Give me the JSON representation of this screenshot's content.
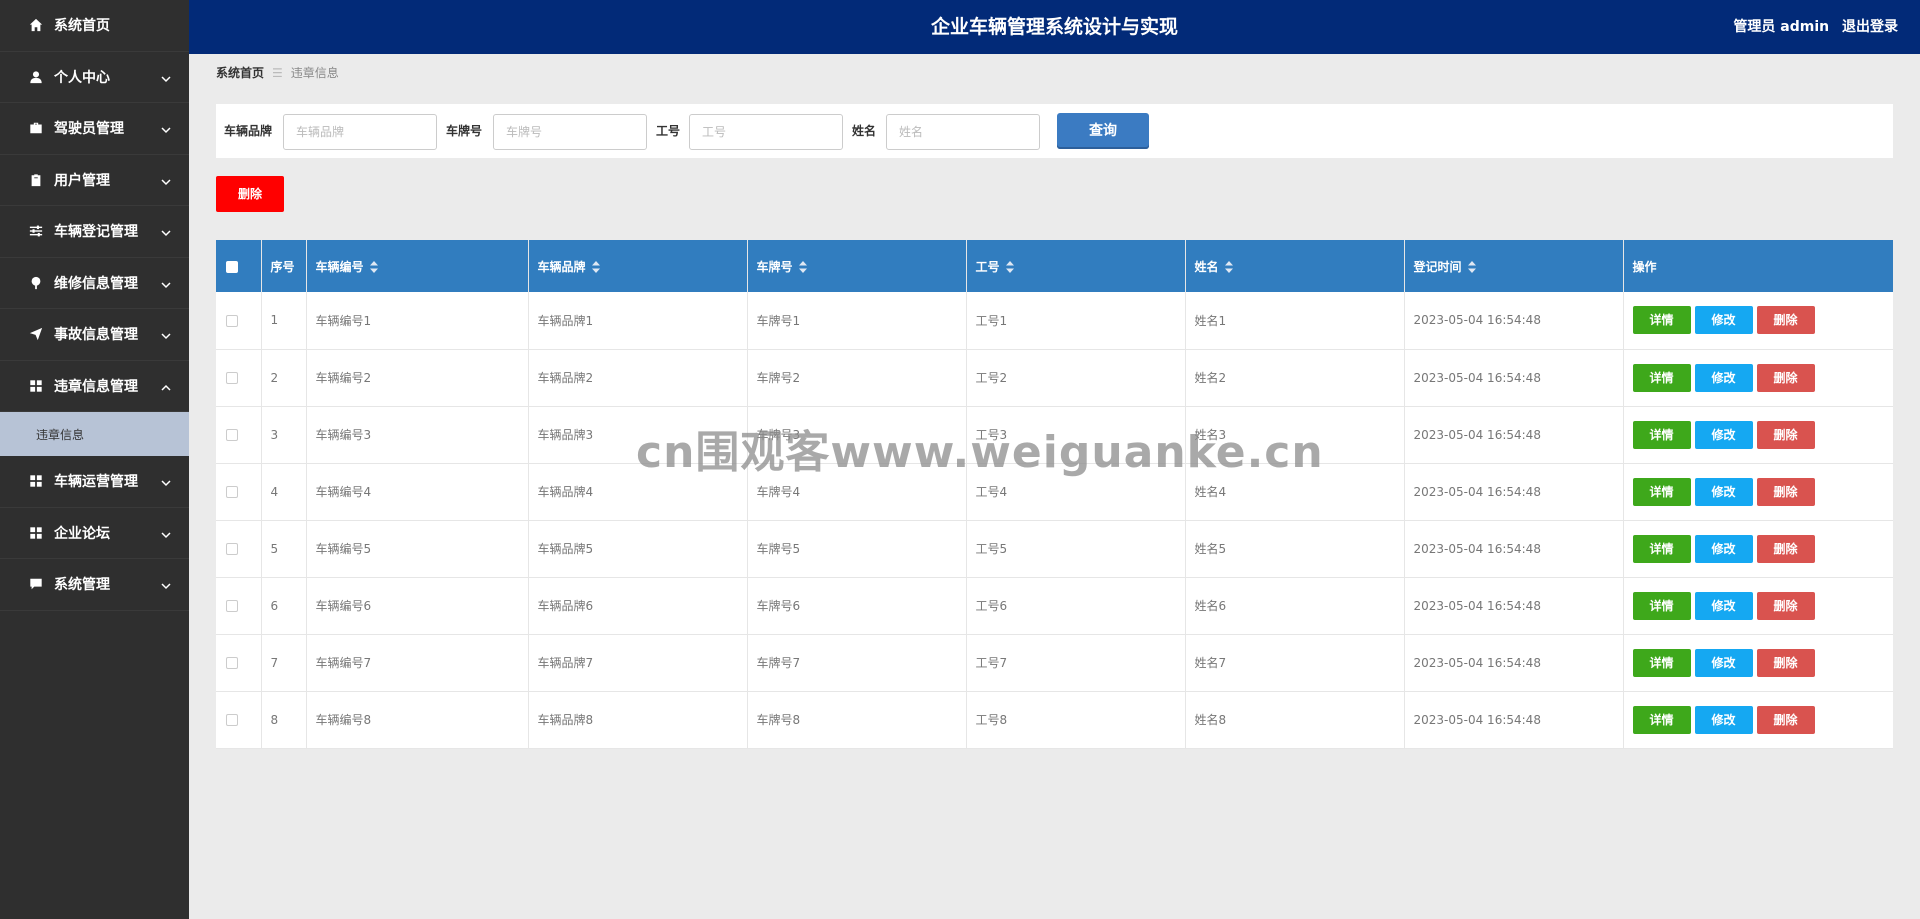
{
  "header": {
    "title": "企业车辆管理系统设计与实现",
    "user": "管理员 admin",
    "logout": "退出登录"
  },
  "sidebar": {
    "items": [
      {
        "label": "系统首页",
        "icon": "home-icon",
        "expandable": false
      },
      {
        "label": "个人中心",
        "icon": "user-icon",
        "expandable": true
      },
      {
        "label": "驾驶员管理",
        "icon": "briefcase-icon",
        "expandable": true
      },
      {
        "label": "用户管理",
        "icon": "clipboard-icon",
        "expandable": true
      },
      {
        "label": "车辆登记管理",
        "icon": "sliders-icon",
        "expandable": true
      },
      {
        "label": "维修信息管理",
        "icon": "pin-icon",
        "expandable": true
      },
      {
        "label": "事故信息管理",
        "icon": "send-icon",
        "expandable": true
      },
      {
        "label": "违章信息管理",
        "icon": "grid-icon",
        "expandable": true,
        "expanded": true
      },
      {
        "label": "车辆运营管理",
        "icon": "grid-icon",
        "expandable": true
      },
      {
        "label": "企业论坛",
        "icon": "grid-icon",
        "expandable": true
      },
      {
        "label": "系统管理",
        "icon": "chat-icon",
        "expandable": true
      }
    ],
    "sub_item": "违章信息"
  },
  "breadcrumb": {
    "home": "系统首页",
    "sep": "☰",
    "current": "违章信息"
  },
  "search": {
    "brand_label": "车辆品牌",
    "brand_placeholder": "车辆品牌",
    "plate_label": "车牌号",
    "plate_placeholder": "车牌号",
    "workno_label": "工号",
    "workno_placeholder": "工号",
    "name_label": "姓名",
    "name_placeholder": "姓名",
    "query_label": "查询"
  },
  "delete_button": "删除",
  "table": {
    "headers": {
      "index": "序号",
      "vehicle_no": "车辆编号",
      "brand": "车辆品牌",
      "plate": "车牌号",
      "workno": "工号",
      "name": "姓名",
      "time": "登记时间",
      "ops": "操作"
    },
    "op_labels": {
      "detail": "详情",
      "edit": "修改",
      "delete": "删除"
    },
    "rows": [
      {
        "index": "1",
        "vehicle_no": "车辆编号1",
        "brand": "车辆品牌1",
        "plate": "车牌号1",
        "workno": "工号1",
        "name": "姓名1",
        "time": "2023-05-04 16:54:48"
      },
      {
        "index": "2",
        "vehicle_no": "车辆编号2",
        "brand": "车辆品牌2",
        "plate": "车牌号2",
        "workno": "工号2",
        "name": "姓名2",
        "time": "2023-05-04 16:54:48"
      },
      {
        "index": "3",
        "vehicle_no": "车辆编号3",
        "brand": "车辆品牌3",
        "plate": "车牌号3",
        "workno": "工号3",
        "name": "姓名3",
        "time": "2023-05-04 16:54:48"
      },
      {
        "index": "4",
        "vehicle_no": "车辆编号4",
        "brand": "车辆品牌4",
        "plate": "车牌号4",
        "workno": "工号4",
        "name": "姓名4",
        "time": "2023-05-04 16:54:48"
      },
      {
        "index": "5",
        "vehicle_no": "车辆编号5",
        "brand": "车辆品牌5",
        "plate": "车牌号5",
        "workno": "工号5",
        "name": "姓名5",
        "time": "2023-05-04 16:54:48"
      },
      {
        "index": "6",
        "vehicle_no": "车辆编号6",
        "brand": "车辆品牌6",
        "plate": "车牌号6",
        "workno": "工号6",
        "name": "姓名6",
        "time": "2023-05-04 16:54:48"
      },
      {
        "index": "7",
        "vehicle_no": "车辆编号7",
        "brand": "车辆品牌7",
        "plate": "车牌号7",
        "workno": "工号7",
        "name": "姓名7",
        "time": "2023-05-04 16:54:48"
      },
      {
        "index": "8",
        "vehicle_no": "车辆编号8",
        "brand": "车辆品牌8",
        "plate": "车牌号8",
        "workno": "工号8",
        "name": "姓名8",
        "time": "2023-05-04 16:54:48"
      }
    ]
  },
  "watermark": "cn围观客www.weiguanke.cn",
  "colors": {
    "header_bg": "#022a78",
    "sidebar_bg": "#2f2f2f",
    "table_header_bg": "#317dbf",
    "detail_btn": "#3ea81b",
    "edit_btn": "#15a8f2",
    "delete_btn": "#d9534f",
    "delete_all_btn": "#ff0000",
    "query_btn": "#3b7bc2"
  }
}
